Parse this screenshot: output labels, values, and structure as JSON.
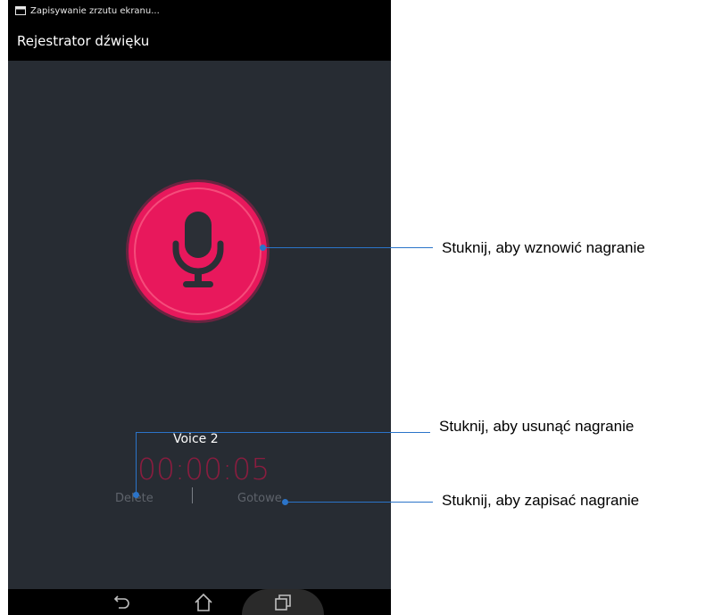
{
  "status_bar": {
    "notification": "Zapisywanie zrzutu ekranu..."
  },
  "action_bar": {
    "title": "Rejestrator dźwięku"
  },
  "recorder": {
    "voice_name": "Voice 2",
    "timer": "00:00:05",
    "delete_label": "Delete",
    "done_label": "Gotowe",
    "accent_color": "#e8185c"
  },
  "nav": {
    "back": "back-icon",
    "home": "home-icon",
    "recent": "recent-apps-icon"
  },
  "callouts": {
    "resume": "Stuknij, aby wznowić nagranie",
    "delete": "Stuknij, aby usunąć nagranie",
    "save": "Stuknij, aby zapisać nagranie"
  }
}
